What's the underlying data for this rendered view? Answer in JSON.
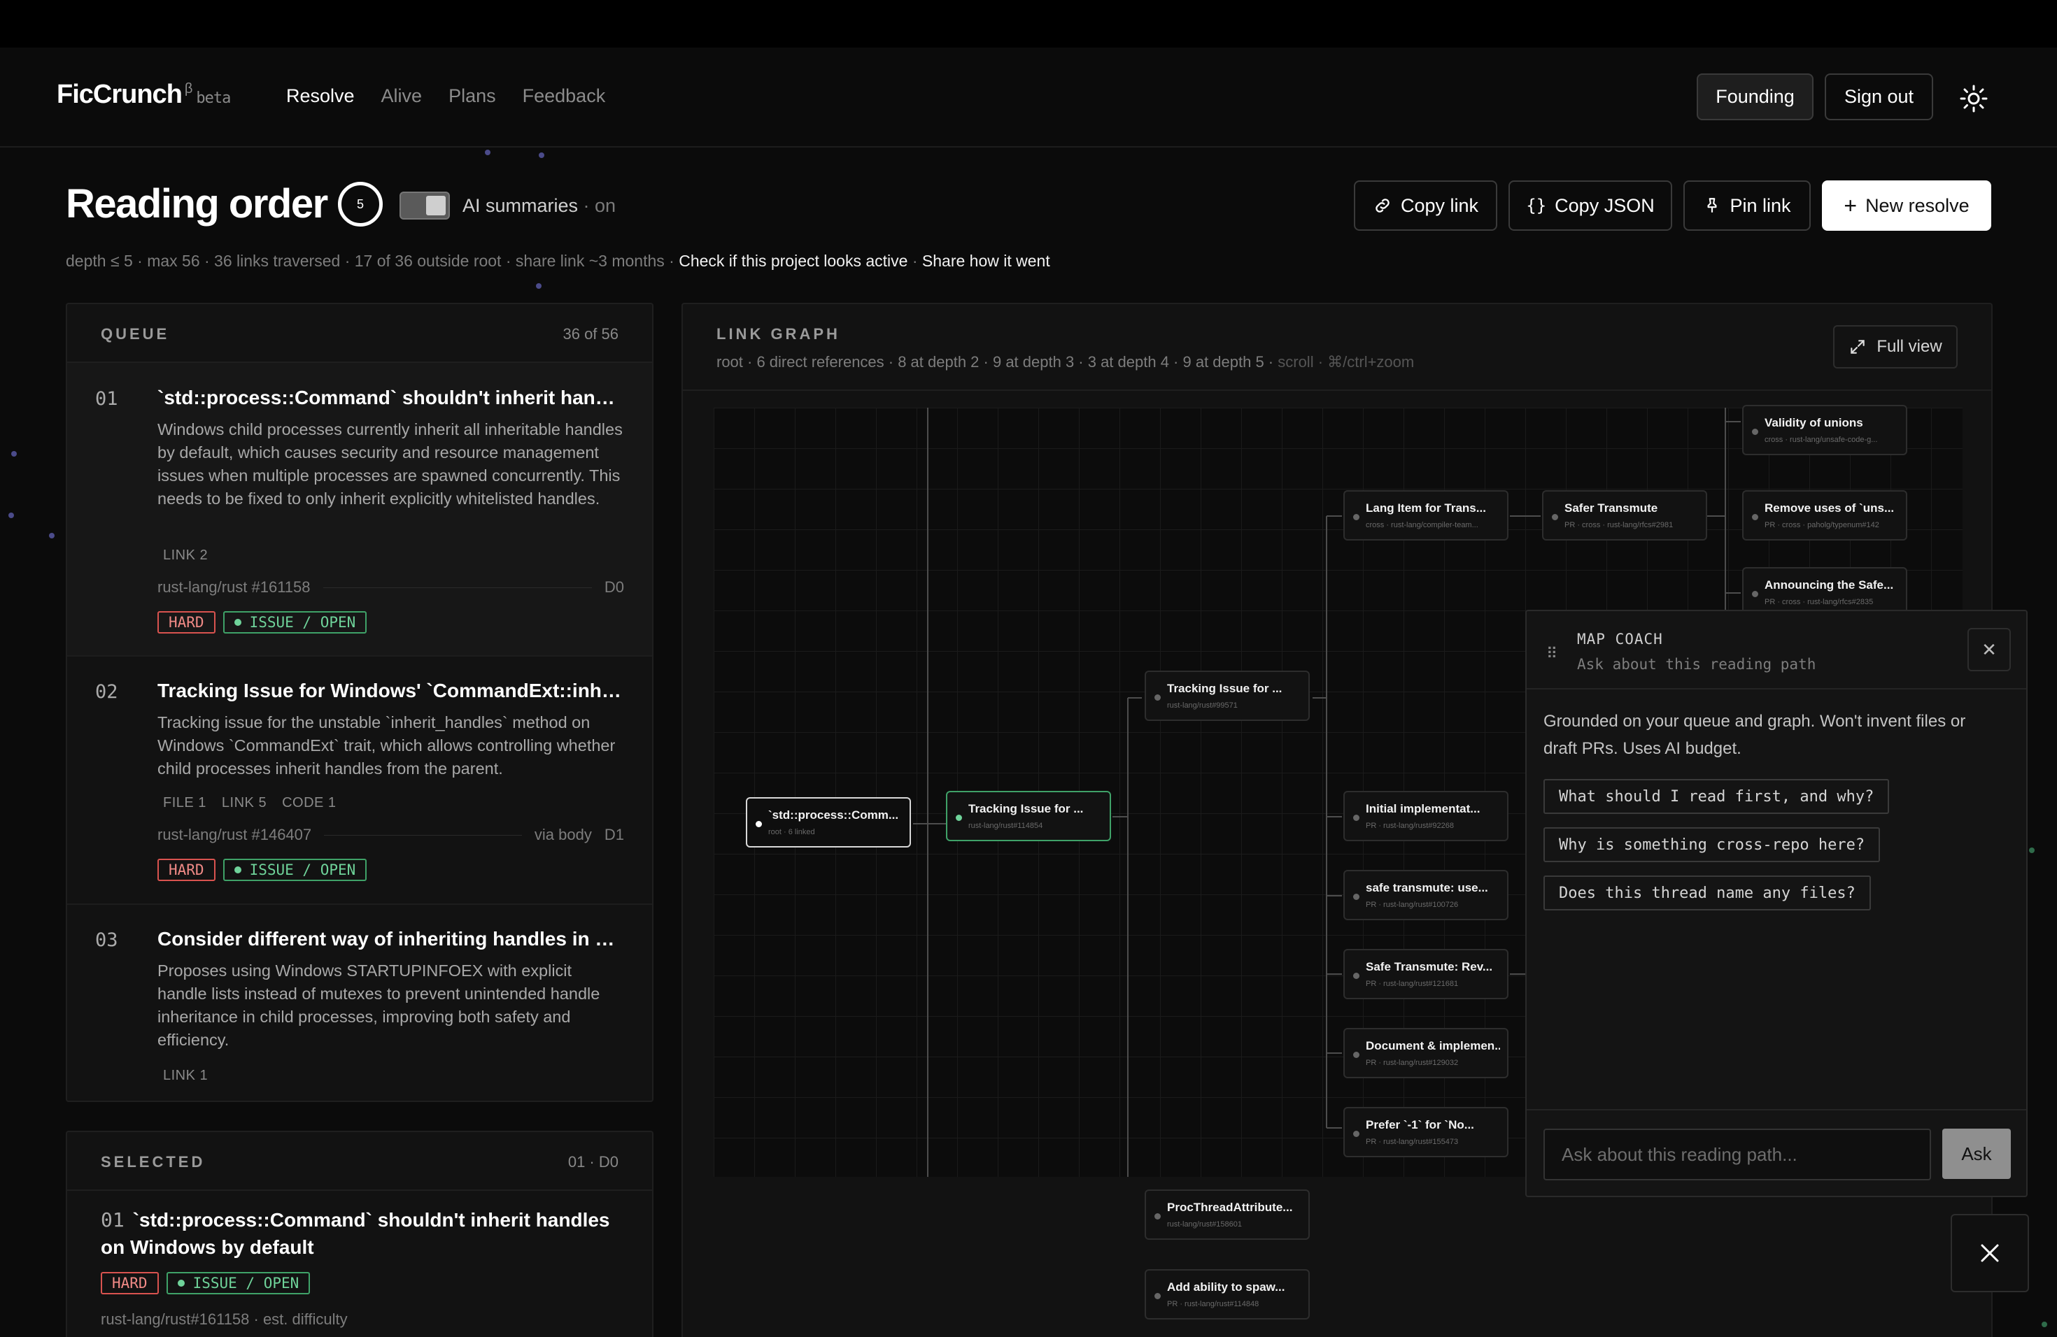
{
  "brand": {
    "name": "FicCrunch",
    "sup": "β",
    "tag": "beta"
  },
  "nav": [
    {
      "label": "Resolve",
      "active": true
    },
    {
      "label": "Alive",
      "active": false
    },
    {
      "label": "Plans",
      "active": false
    },
    {
      "label": "Feedback",
      "active": false
    }
  ],
  "header_buttons": {
    "founding": "Founding",
    "sign_out": "Sign out",
    "theme_icon": "sun-icon"
  },
  "page": {
    "title": "Reading order",
    "depth_ring": "5",
    "ai_label": "AI summaries",
    "ai_state": " · on",
    "meta_dim": "depth ≤ 5 · max 56 · 36 links traversed · 17 of 36 outside root · share link ~3 months · ",
    "meta_link1": "Check if this project looks active",
    "meta_sep": " · ",
    "meta_link2": "Share how it went"
  },
  "actions": {
    "copy_link": "Copy link",
    "copy_json": "Copy JSON",
    "pin_link": "Pin link",
    "new_resolve": "New resolve"
  },
  "queue": {
    "label": "QUEUE",
    "count": "36 of 56",
    "items": [
      {
        "num": "01",
        "title": "`std::process::Command` shouldn't inherit handles on Windows by default",
        "desc": "Windows child processes currently inherit all inheritable handles by default, which causes security and resource management issues when multiple processes are spawned concurrently. This needs to be fixed to only inherit explicitly whitelisted handles.",
        "tags": [
          "LINK 2"
        ],
        "repo": "rust-lang/rust #161158",
        "via": "",
        "depth": "D0",
        "difficulty": "HARD",
        "status": "ISSUE / OPEN"
      },
      {
        "num": "02",
        "title": "Tracking Issue for Windows' `CommandExt::inherit_handles`",
        "desc": "Tracking issue for the unstable `inherit_handles` method on Windows `CommandExt` trait, which allows controlling whether child processes inherit handles from the parent.",
        "tags": [
          "FILE 1",
          "LINK 5",
          "CODE 1"
        ],
        "repo": "rust-lang/rust #146407",
        "via": "via body",
        "depth": "D1",
        "difficulty": "HARD",
        "status": "ISSUE / OPEN"
      },
      {
        "num": "03",
        "title": "Consider different way of inheriting handles in child processes",
        "desc": "Proposes using Windows STARTUPINFOEX with explicit handle lists instead of mutexes to prevent unintended handle inheritance in child processes, improving both safety and efficiency.",
        "tags": [
          "LINK 1"
        ]
      }
    ]
  },
  "selected": {
    "label": "SELECTED",
    "count": "01 · D0",
    "num": "01",
    "title": "`std::process::Command` shouldn't inherit handles on Windows by default",
    "difficulty": "HARD",
    "status": "ISSUE / OPEN",
    "repo": "rust-lang/rust#161158 · est. difficulty"
  },
  "graph": {
    "label": "LINK GRAPH",
    "sub": "root · 6 direct references · 8 at depth 2 · 9 at depth 3 · 3 at depth 4 · 9 at depth 5 · ",
    "sub_dim": "scroll · ⌘/ctrl+zoom",
    "full_view": "Full view",
    "nodes": [
      {
        "id": "root",
        "title": "`std::process::Comm...",
        "sub": "root · 6 linked"
      },
      {
        "id": "n1",
        "title": "Tracking Issue for ...",
        "sub": "rust-lang/rust#114854"
      },
      {
        "id": "n2",
        "title": "Tracking Issue for ...",
        "sub": "rust-lang/rust#99571"
      },
      {
        "id": "n3",
        "title": "ProcThreadAttribute...",
        "sub": "rust-lang/rust#158601"
      },
      {
        "id": "n4",
        "title": "Add ability to spaw...",
        "sub": "PR · rust-lang/rust#114848"
      },
      {
        "id": "n5",
        "title": "Lang Item for Trans...",
        "sub": "cross · rust-lang/compiler-team..."
      },
      {
        "id": "n6",
        "title": "Initial implementat...",
        "sub": "PR · rust-lang/rust#92268"
      },
      {
        "id": "n7",
        "title": "safe transmute: use...",
        "sub": "PR · rust-lang/rust#100726"
      },
      {
        "id": "n8",
        "title": "Safe Transmute: Rev...",
        "sub": "PR · rust-lang/rust#121681"
      },
      {
        "id": "n9",
        "title": "Document & implemen...",
        "sub": "PR · rust-lang/rust#129032"
      },
      {
        "id": "n10",
        "title": "Prefer `-1` for `No...",
        "sub": "PR · rust-lang/rust#155473"
      },
      {
        "id": "n11",
        "title": "Safer Transmute",
        "sub": "PR · cross · rust-lang/rfcs#2981"
      },
      {
        "id": "n12",
        "title": "Validity of unions",
        "sub": "cross · rust-lang/unsafe-code-g..."
      },
      {
        "id": "n13",
        "title": "Remove uses of `uns...",
        "sub": "PR · cross · paholg/typenum#142"
      },
      {
        "id": "n14",
        "title": "Announcing the Safe...",
        "sub": "PR · cross · rust-lang/rfcs#2835"
      }
    ]
  },
  "coach": {
    "title": "MAP COACH",
    "sub": "Ask about this reading path",
    "body": "Grounded on your queue and graph. Won't invent files or draft PRs. Uses AI budget.",
    "suggestions": [
      "What should I read first, and why?",
      "Why is something cross-repo here?",
      "Does this thread name any files?"
    ],
    "input_placeholder": "Ask about this reading path...",
    "ask": "Ask"
  },
  "colors": {
    "accent_green": "#3fa268",
    "hard_red": "#d9534f",
    "background": "#0b0b0b"
  }
}
